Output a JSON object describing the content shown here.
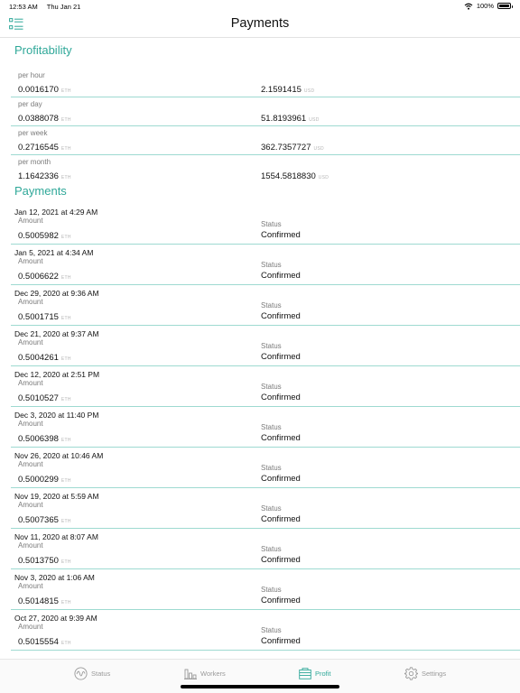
{
  "status_bar": {
    "time": "12:53 AM",
    "date": "Thu Jan 21",
    "battery": "100%",
    "battery_level": 1.0
  },
  "header": {
    "title": "Payments"
  },
  "profitability": {
    "title": "Profitability",
    "rows": [
      {
        "label": "per hour",
        "eth": "0.0016170",
        "eth_unit": "ETH",
        "usd": "2.1591415",
        "usd_unit": "USD"
      },
      {
        "label": "per day",
        "eth": "0.0388078",
        "eth_unit": "ETH",
        "usd": "51.8193961",
        "usd_unit": "USD"
      },
      {
        "label": "per week",
        "eth": "0.2716545",
        "eth_unit": "ETH",
        "usd": "362.7357727",
        "usd_unit": "USD"
      },
      {
        "label": "per month",
        "eth": "1.1642336",
        "eth_unit": "ETH",
        "usd": "1554.5818830",
        "usd_unit": "USD"
      }
    ]
  },
  "payments": {
    "title": "Payments",
    "amount_label": "Amount",
    "status_label": "Status",
    "unit": "ETH",
    "items": [
      {
        "date": "Jan 12, 2021 at 4:29 AM",
        "amount": "0.5005982",
        "status": "Confirmed"
      },
      {
        "date": "Jan 5, 2021 at 4:34 AM",
        "amount": "0.5006622",
        "status": "Confirmed"
      },
      {
        "date": "Dec 29, 2020 at 9:36 AM",
        "amount": "0.5001715",
        "status": "Confirmed"
      },
      {
        "date": "Dec 21, 2020 at 9:37 AM",
        "amount": "0.5004261",
        "status": "Confirmed"
      },
      {
        "date": "Dec 12, 2020 at 2:51 PM",
        "amount": "0.5010527",
        "status": "Confirmed"
      },
      {
        "date": "Dec 3, 2020 at 11:40 PM",
        "amount": "0.5006398",
        "status": "Confirmed"
      },
      {
        "date": "Nov 26, 2020 at 10:46 AM",
        "amount": "0.5000299",
        "status": "Confirmed"
      },
      {
        "date": "Nov 19, 2020 at 5:59 AM",
        "amount": "0.5007365",
        "status": "Confirmed"
      },
      {
        "date": "Nov 11, 2020 at 8:07 AM",
        "amount": "0.5013750",
        "status": "Confirmed"
      },
      {
        "date": "Nov 3, 2020 at 1:06 AM",
        "amount": "0.5014815",
        "status": "Confirmed"
      },
      {
        "date": "Oct 27, 2020 at 9:39 AM",
        "amount": "0.5015554",
        "status": "Confirmed"
      }
    ]
  },
  "tab_bar": {
    "tabs": [
      {
        "label": "Status",
        "icon": "pulse-icon"
      },
      {
        "label": "Workers",
        "icon": "bar-chart-icon"
      },
      {
        "label": "Profit",
        "icon": "wallet-icon",
        "active": true
      },
      {
        "label": "Settings",
        "icon": "gear-icon"
      }
    ]
  },
  "colors": {
    "accent": "#2fa899",
    "divider": "#9edad1",
    "muted": "#9a9a9a"
  }
}
